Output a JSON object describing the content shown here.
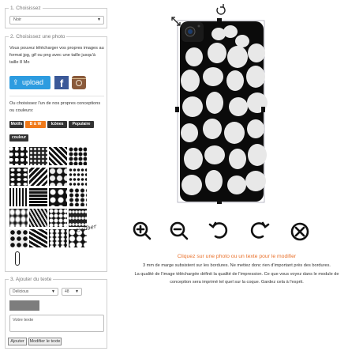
{
  "panel1": {
    "legend": "1. Choisissez",
    "select_value": "Noir"
  },
  "panel2": {
    "legend": "2. Choisissez une photo",
    "upload_text": "Vous pouvez télécharger vos propres images au format jpg, gif ou png avec une taille jusqu'à taille 8 Mo",
    "upload_label": "upload",
    "facebook_glyph": "f",
    "design_text": "Ou choisissez l'un de nos propres conceptions ou couleurs:",
    "categories": [
      "Motifs",
      "B & W",
      "Icônes",
      "Populaire",
      "couleur"
    ],
    "active_category": "B & W",
    "signature_text": "Caliber"
  },
  "panel3": {
    "legend": "3. Ajouter du texte",
    "font_value": "Delicious",
    "size_value": "48",
    "text_placeholder": "Votre texte",
    "add_button": "Ajouter",
    "edit_button": "Modifier le texte",
    "color": "#7d7d7d"
  },
  "toolbar": {
    "icons": [
      "zoom-in-icon",
      "zoom-out-icon",
      "rotate-left-icon",
      "rotate-right-icon",
      "delete-icon"
    ]
  },
  "messages": {
    "title": "Cliquez sur une photo ou un texte pour le modifier",
    "line1": "3 mm de marge subsistent sur les bordures. Ne mettez donc rien d'important près des bordures.",
    "line2": "La qualité de l'image téléchargée définit la qualité de l'impression. Ce que vous voyez dans le module de",
    "line3": "conception sera imprimé tel quel sur la coque. Gardez cela à l'esprit."
  },
  "colors": {
    "accent": "#f07a1a",
    "upload": "#2d9ce0",
    "facebook": "#3b5998",
    "dark_button": "#333333"
  }
}
